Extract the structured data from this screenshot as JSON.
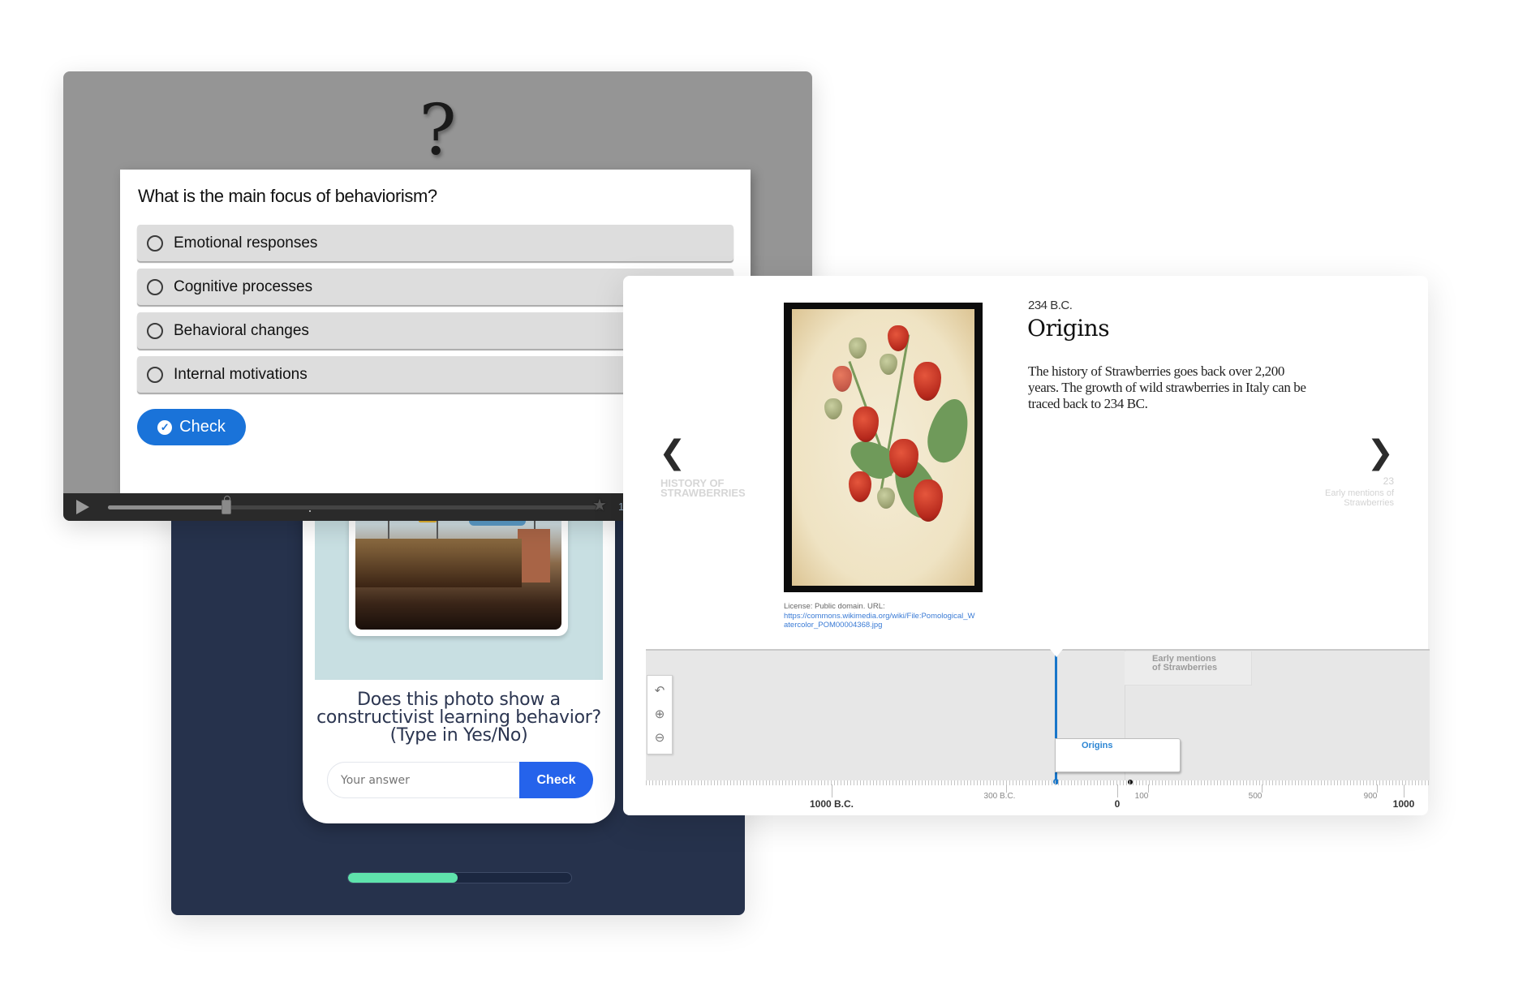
{
  "video_quiz": {
    "icon": "?",
    "question": "What is the main focus of behaviorism?",
    "options": [
      {
        "label": "Emotional responses",
        "selected": false
      },
      {
        "label": "Cognitive processes",
        "selected": false
      },
      {
        "label": "Behavioral changes",
        "selected": false
      },
      {
        "label": "Internal motivations",
        "selected": false
      }
    ],
    "check_label": "Check",
    "player": {
      "progress_fraction": 0.24,
      "time_text": "1"
    }
  },
  "photo_quiz": {
    "image_alt": "Boy working at a desk in an art classroom",
    "question": "Does this photo show a constructivist learning behavior? (Type in Yes/No)",
    "input_placeholder": "Your answer",
    "input_value": "",
    "check_label": "Check",
    "progress_fraction": 0.49,
    "colors": {
      "panel_bg": "#26324c",
      "accent": "#2563eb",
      "progress": "#5fe3ac"
    }
  },
  "timeline": {
    "prev": {
      "label": "HISTORY OF STRAWBERRIES"
    },
    "next": {
      "number": "23",
      "label": "Early mentions of Strawberries"
    },
    "slide": {
      "date": "234 B.C.",
      "title": "Origins",
      "body": "The history of Strawberries goes back over 2,200 years. The growth of wild strawberries in Italy can be traced back to 234 BC.",
      "media_alt": "Pomological watercolor of strawberries",
      "license_text": "License: Public domain. URL:",
      "license_url": "https://commons.wikimedia.org/wiki/File:Pomological_Watercolor_POM00004368.jpg"
    },
    "tools": [
      {
        "name": "back-to-start",
        "glyph": "↶"
      },
      {
        "name": "zoom-in",
        "glyph": "⊕"
      },
      {
        "name": "zoom-out",
        "glyph": "⊖"
      }
    ],
    "markers": [
      {
        "title": "Origins",
        "active": true
      },
      {
        "title": "Early mentions of Strawberries",
        "active": false
      }
    ],
    "axis": {
      "ticks": [
        {
          "label": "1000 B.C.",
          "major": true
        },
        {
          "label": "300 B.C.",
          "major": false
        },
        {
          "label": "0",
          "major": true
        },
        {
          "label": "100",
          "major": false
        },
        {
          "label": "500",
          "major": false
        },
        {
          "label": "900",
          "major": false
        },
        {
          "label": "1000",
          "major": true
        }
      ]
    },
    "colors": {
      "accent": "#1976c9"
    }
  }
}
